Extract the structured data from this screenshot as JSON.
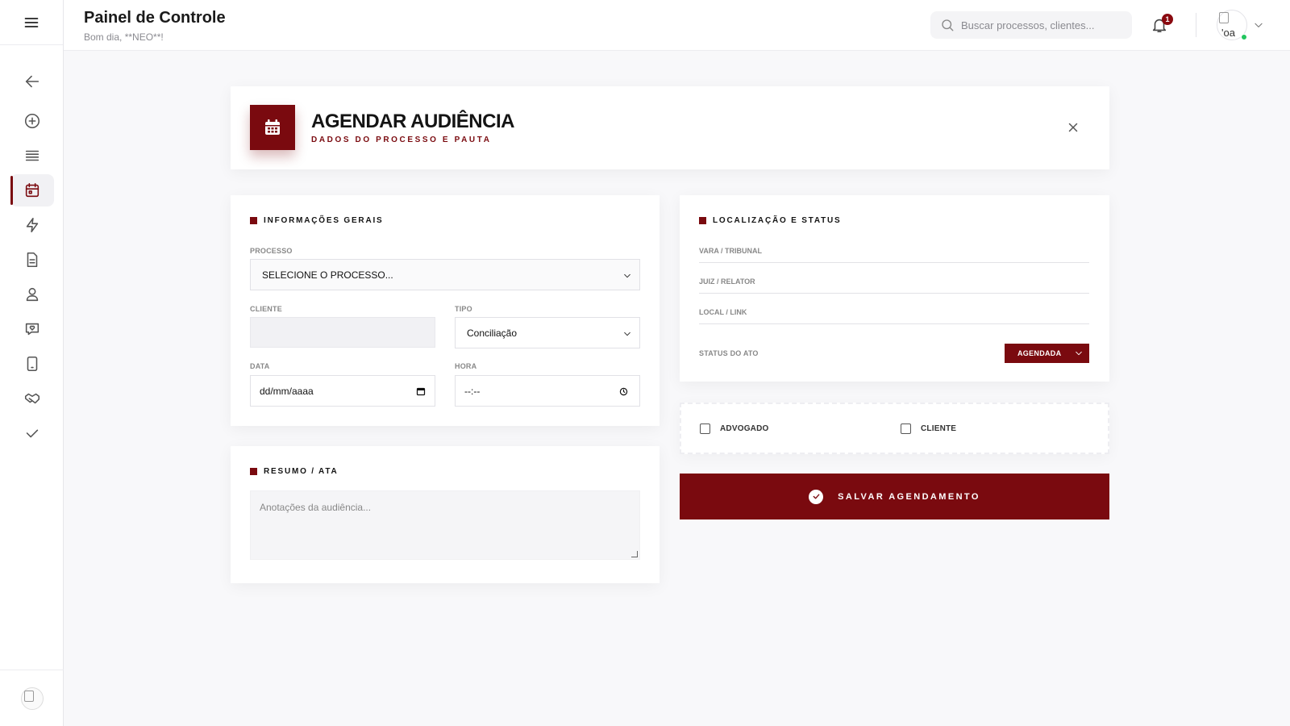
{
  "header": {
    "title": "Painel de Controle",
    "greeting": "Bom dia, **NEO**!",
    "search_placeholder": "Buscar processos, clientes...",
    "notification_count": "1",
    "profile_alt": "'oa"
  },
  "sidebar": {
    "items": [
      {
        "name": "back",
        "icon": "arrow-left-icon"
      },
      {
        "name": "add",
        "icon": "plus-circle-icon"
      },
      {
        "name": "list",
        "icon": "list-icon"
      },
      {
        "name": "calendar",
        "icon": "calendar-icon",
        "active": true
      },
      {
        "name": "actions",
        "icon": "lightning-icon"
      },
      {
        "name": "documents",
        "icon": "document-icon"
      },
      {
        "name": "clients",
        "icon": "user-icon"
      },
      {
        "name": "messages",
        "icon": "chat-heart-icon"
      },
      {
        "name": "tablet",
        "icon": "tablet-icon"
      },
      {
        "name": "handshake",
        "icon": "handshake-icon"
      },
      {
        "name": "done",
        "icon": "check-icon"
      }
    ]
  },
  "modal": {
    "title": "AGENDAR AUDIÊNCIA",
    "subtitle": "DADOS DO PROCESSO E PAUTA"
  },
  "general": {
    "section_title": "INFORMAÇÕES GERAIS",
    "process_label": "PROCESSO",
    "process_value": "SELECIONE O PROCESSO...",
    "client_label": "CLIENTE",
    "client_value": "",
    "type_label": "TIPO",
    "type_value": "Conciliação",
    "date_label": "DATA",
    "date_value": "dd/mm/aaaa",
    "time_label": "HORA",
    "time_value": "--:--"
  },
  "summary": {
    "section_title": "RESUMO / ATA",
    "placeholder": "Anotações da audiência..."
  },
  "location": {
    "section_title": "LOCALIZAÇÃO E STATUS",
    "court_label": "VARA / TRIBUNAL",
    "judge_label": "JUIZ / RELATOR",
    "place_label": "LOCAL / LINK",
    "status_label": "STATUS DO ATO",
    "status_value": "AGENDADA"
  },
  "notify": {
    "lawyer_label": "ADVOGADO",
    "client_label": "CLIENTE"
  },
  "actions": {
    "save_label": "SALVAR AGENDAMENTO"
  },
  "colors": {
    "accent": "#7a0a0f",
    "online": "#22c55e"
  }
}
